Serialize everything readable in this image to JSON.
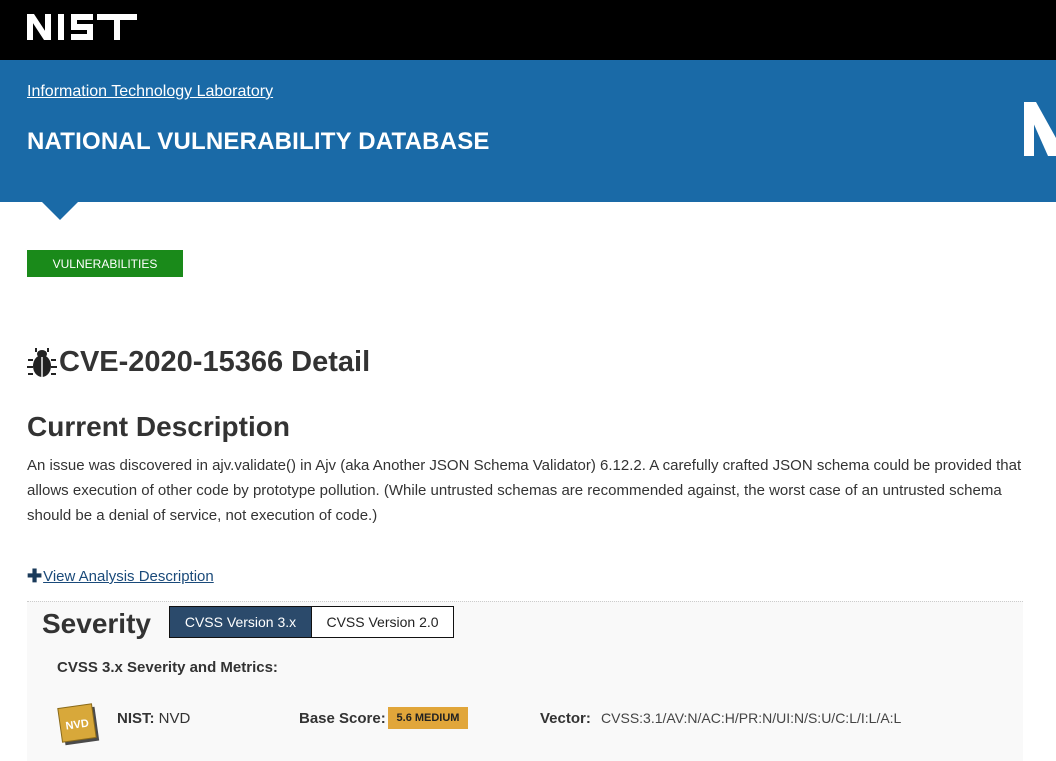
{
  "topbar": {
    "logo_text": "NIST",
    "logo_icon": "nist-logo"
  },
  "header": {
    "lab_link": "Information Technology Laboratory",
    "title": "NATIONAL VULNERABILITY DATABASE",
    "logo_icon": "nvd-logo"
  },
  "nav": {
    "vulnerabilities_button": "VULNERABILITIES"
  },
  "cve": {
    "title_icon": "bug-icon",
    "title": "CVE-2020-15366 Detail"
  },
  "description": {
    "heading": "Current Description",
    "text": "An issue was discovered in ajv.validate() in Ajv (aka Another JSON Schema Validator) 6.12.2. A carefully crafted JSON schema could be provided that allows execution of other code by prototype pollution. (While untrusted schemas are recommended against, the worst case of an untrusted schema should be a denial of service, not execution of code.)",
    "view_analysis_icon": "plus-icon",
    "view_analysis_label": "View Analysis Description"
  },
  "severity": {
    "heading": "Severity",
    "tabs": [
      {
        "label": "CVSS Version 3.x",
        "active": true
      },
      {
        "label": "CVSS Version 2.0",
        "active": false
      }
    ],
    "metrics_heading": "CVSS 3.x Severity and Metrics:",
    "source_icon": "nvd-badge-icon",
    "source_label": "NIST:",
    "source_value": "NVD",
    "base_score_label": "Base Score:",
    "base_score_value": "5.6 MEDIUM",
    "vector_label": "Vector:",
    "vector_value": "CVSS:3.1/AV:N/AC:H/PR:N/UI:N/S:U/C:L/I:L/A:L"
  },
  "colors": {
    "topbar": "#000000",
    "header": "#1a6aa7",
    "vulnerabilities_button": "#1a8a1a",
    "active_tab": "#2b4a6b",
    "medium_badge": "#e1a63a"
  }
}
